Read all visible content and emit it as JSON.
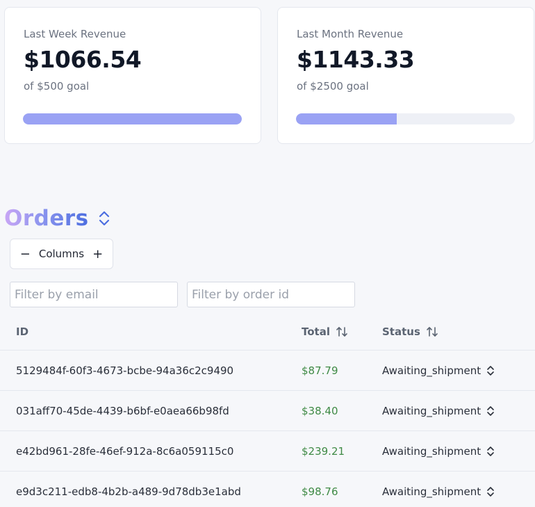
{
  "cards": [
    {
      "label": "Last Week Revenue",
      "value": "$1066.54",
      "goal": "of $500 goal",
      "progress": 1.0
    },
    {
      "label": "Last Month Revenue",
      "value": "$1143.33",
      "goal": "of $2500 goal",
      "progress": 0.46
    }
  ],
  "colors": {
    "progress_fill": "#9aa2f4",
    "progress_track": "#eef0f6",
    "total_green": "#3f8a45"
  },
  "orders": {
    "title": "Orders",
    "columns_button": {
      "minus": "−",
      "label": "Columns",
      "plus": "+"
    },
    "filters": {
      "email_placeholder": "Filter by email",
      "order_placeholder": "Filter by order id"
    },
    "headers": {
      "id": "ID",
      "total": "Total",
      "status": "Status"
    },
    "rows": [
      {
        "id": "5129484f-60f3-4673-bcbe-94a36c2c9490",
        "total": "$87.79",
        "status": "Awaiting_shipment"
      },
      {
        "id": "031aff70-45de-4439-b6bf-e0aea66b98fd",
        "total": "$38.40",
        "status": "Awaiting_shipment"
      },
      {
        "id": "e42bd961-28fe-46ef-912a-8c6a059115c0",
        "total": "$239.21",
        "status": "Awaiting_shipment"
      },
      {
        "id": "e9d3c211-edb8-4b2b-a489-9d78db3e1abd",
        "total": "$98.76",
        "status": "Awaiting_shipment"
      }
    ]
  }
}
